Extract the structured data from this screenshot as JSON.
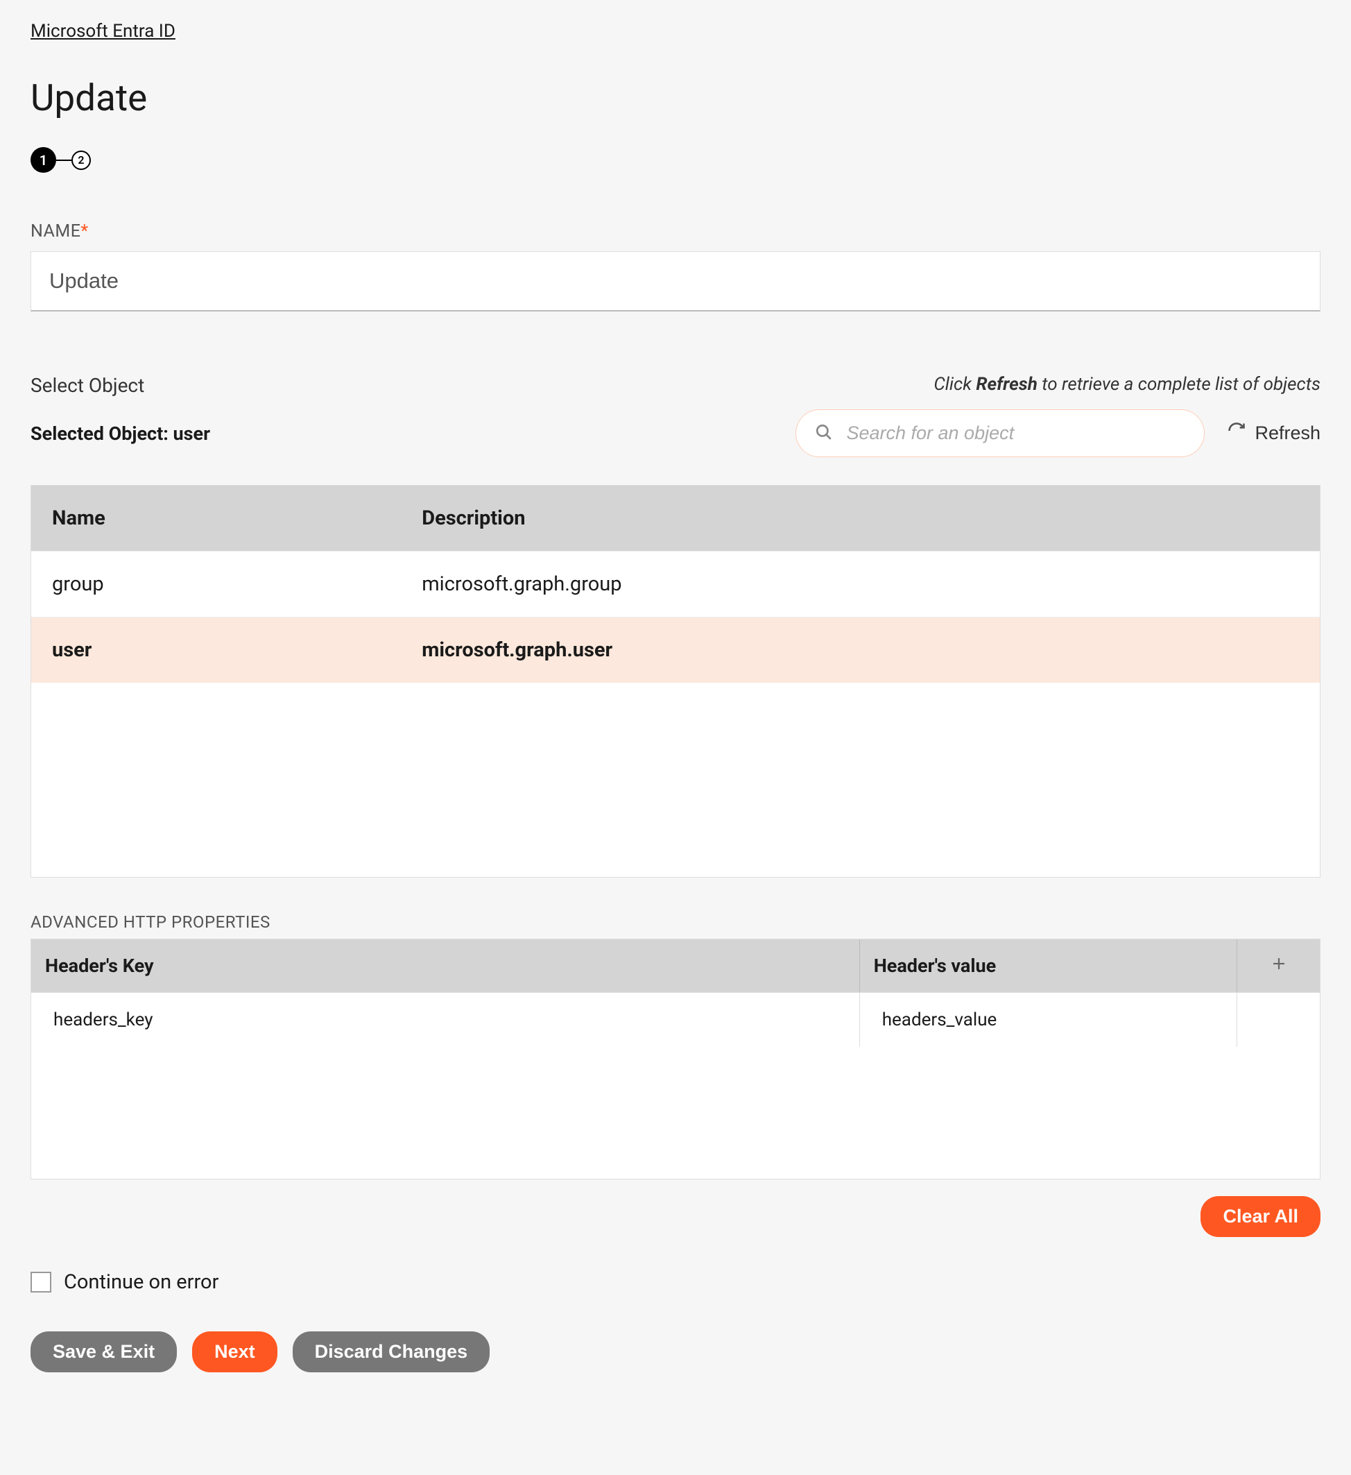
{
  "breadcrumb": "Microsoft Entra ID",
  "page_title": "Update",
  "stepper": {
    "step1": "1",
    "step2": "2"
  },
  "name_field": {
    "label": "NAME",
    "value": "Update"
  },
  "select_object": {
    "label": "Select Object",
    "hint_prefix": "Click ",
    "hint_bold": "Refresh",
    "hint_suffix": " to retrieve a complete list of objects",
    "selected_label": "Selected Object: user",
    "search_placeholder": "Search for an object",
    "refresh_label": "Refresh"
  },
  "object_table": {
    "headers": {
      "name": "Name",
      "description": "Description"
    },
    "rows": [
      {
        "name": "group",
        "description": "microsoft.graph.group",
        "selected": false
      },
      {
        "name": "user",
        "description": "microsoft.graph.user",
        "selected": true
      }
    ]
  },
  "http_section": {
    "label": "ADVANCED HTTP PROPERTIES",
    "headers": {
      "key": "Header's Key",
      "value": "Header's value"
    },
    "rows": [
      {
        "key": "headers_key",
        "value": "headers_value"
      }
    ]
  },
  "buttons": {
    "clear_all": "Clear All",
    "continue_on_error": "Continue on error",
    "save_exit": "Save & Exit",
    "next": "Next",
    "discard": "Discard Changes"
  }
}
